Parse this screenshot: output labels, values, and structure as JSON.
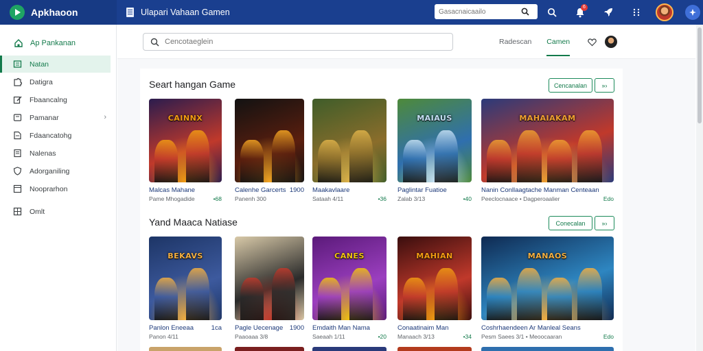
{
  "app": {
    "name": "Apkhaoon",
    "window_title": "Ulapari Vahaan Gamen"
  },
  "top_search": {
    "placeholder": "Gasacnaicaailo"
  },
  "notifications": {
    "count": "6"
  },
  "sidebar": {
    "header": "Ap Pankanan",
    "items": [
      {
        "label": "Natan",
        "icon": "list-icon",
        "active": true
      },
      {
        "label": "Datigra",
        "icon": "puzzle-icon"
      },
      {
        "label": "Fbaancalng",
        "icon": "edit-icon"
      },
      {
        "label": "Pamanar",
        "icon": "folder-icon",
        "chevron": true
      },
      {
        "label": "Fdaancatohg",
        "icon": "document-icon"
      },
      {
        "label": "Nalenas",
        "icon": "file-icon"
      },
      {
        "label": "Adorganiling",
        "icon": "shield-icon"
      },
      {
        "label": "Nooprarhon",
        "icon": "note-icon"
      },
      {
        "label": "Omlt",
        "icon": "grid-icon"
      }
    ]
  },
  "main_search": {
    "placeholder": "Cencotaeglein"
  },
  "tabs": [
    {
      "label": "Radescan"
    },
    {
      "label": "Camen",
      "active": true
    }
  ],
  "sections": [
    {
      "title": "Seart hangan Game",
      "button_label": "Cencanalan",
      "more_label": "»›",
      "cards": [
        {
          "title": "Malcas Mahane",
          "price": "",
          "meta": "Pame Mhogadide",
          "tag": "•68",
          "logo": "CAINNX",
          "palette": [
            "#2b1c4e",
            "#c0392b",
            "#f39c12"
          ]
        },
        {
          "title": "Calenhe Garcerts",
          "price": "1900",
          "meta": "Panenh 300",
          "tag": "",
          "logo": "",
          "palette": [
            "#121212",
            "#5a1e0e",
            "#f5a623"
          ]
        },
        {
          "title": "Maakavlaare",
          "price": "",
          "meta": "Sataah 4/11",
          "tag": "•36",
          "logo": "",
          "palette": [
            "#3f5d2a",
            "#8a6d2b",
            "#e0b34a"
          ]
        },
        {
          "title": "Paglintar Fuatioe",
          "price": "",
          "meta": "Zalab 3/13",
          "tag": "•40",
          "logo": "MAIAUS",
          "palette": [
            "#4e8a3a",
            "#2f6fae",
            "#c6e0f5"
          ]
        },
        {
          "title": "Nanin Conllaagtache Manman Centeaan",
          "price": "",
          "meta": "Peeclocnaace • Dagperoaalier",
          "tag": "Edo",
          "logo": "MAHAIAKAM",
          "palette": [
            "#2b3a7a",
            "#c0392b",
            "#f0a030"
          ]
        }
      ]
    },
    {
      "title": "Yand Maaca Natiase",
      "button_label": "Conecalan",
      "more_label": "»›",
      "cards": [
        {
          "title": "Panlon Eneeaa",
          "price": "1ca",
          "meta": "Panon 4/11",
          "tag": "",
          "logo": "BEKAVS",
          "palette": [
            "#1d3566",
            "#3d5a9e",
            "#f5b041"
          ]
        },
        {
          "title": "Pagle Uecenage",
          "price": "1900",
          "meta": "Paaoaaa 3/8",
          "tag": "",
          "logo": "",
          "palette": [
            "#d8c9a8",
            "#2a2a2a",
            "#c0392b"
          ]
        },
        {
          "title": "Emdaith Man Nama",
          "price": "",
          "meta": "Saeaah 1/11",
          "tag": "•20",
          "logo": "CANES",
          "palette": [
            "#5b1a7a",
            "#9b3fbf",
            "#f1c40f"
          ]
        },
        {
          "title": "Conaatinaim Man",
          "price": "",
          "meta": "Manaach 3/13",
          "tag": "•34",
          "logo": "MAHIAN",
          "palette": [
            "#3a0e0e",
            "#c0392b",
            "#f39c12"
          ]
        },
        {
          "title": "Coshrhaendeen Ar Manleal Seans",
          "price": "",
          "meta": "Pesm Saees 3/1 • Meoocaaran",
          "tag": "Edo",
          "logo": "MANAOS",
          "palette": [
            "#0f2a52",
            "#2e86c1",
            "#f5b041"
          ]
        }
      ]
    }
  ],
  "colors": {
    "topbar": "#1a3f8f",
    "accent": "#137a4b",
    "link": "#1d3a7a"
  }
}
